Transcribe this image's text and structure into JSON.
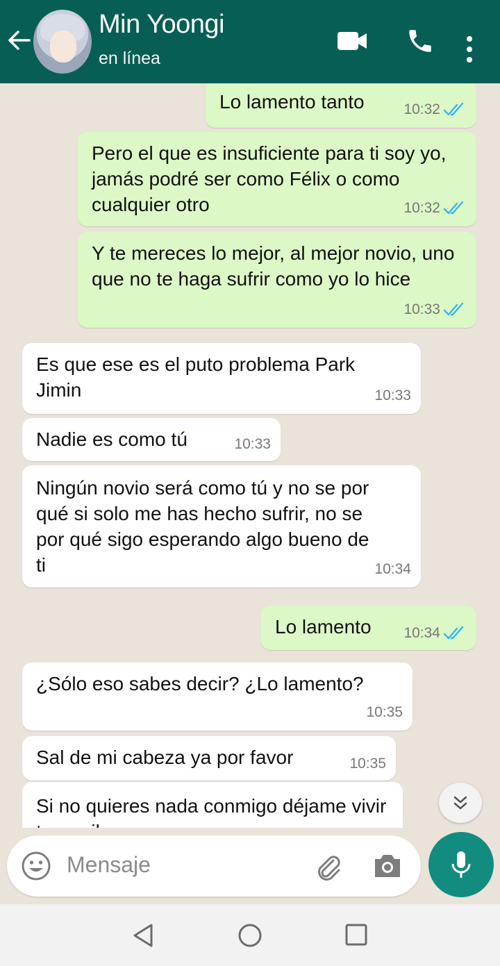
{
  "header": {
    "contact_name": "Min Yoongi",
    "status": "en línea",
    "icons": [
      "back-arrow-icon",
      "video-call-icon",
      "voice-call-icon",
      "more-options-icon"
    ]
  },
  "messages": [
    {
      "direction": "out",
      "text": "Lo lamento tanto",
      "time": "10:32",
      "read": true
    },
    {
      "direction": "out",
      "text": "Pero el que es insuficiente para ti soy yo, jamás podré ser como Félix o como cualquier otro",
      "time": "10:32",
      "read": true
    },
    {
      "direction": "out",
      "text": "Y te mereces lo mejor, al mejor novio, uno que no te haga sufrir como yo lo hice",
      "time": "10:33",
      "read": true
    },
    {
      "direction": "in",
      "text": "Es que ese es el puto problema Park Jimin",
      "time": "10:33"
    },
    {
      "direction": "in",
      "text": "Nadie es como tú",
      "time": "10:33"
    },
    {
      "direction": "in",
      "text": "Ningún novio será como tú y no se por qué si solo me has hecho sufrir, no se por qué sigo esperando algo bueno de ti",
      "time": "10:34"
    },
    {
      "direction": "out",
      "text": "Lo lamento",
      "time": "10:34",
      "read": true
    },
    {
      "direction": "in",
      "text": "¿Sólo eso sabes decir? ¿Lo lamento?",
      "time": "10:35"
    },
    {
      "direction": "in",
      "text": "Sal de mi cabeza ya por favor",
      "time": "10:35"
    },
    {
      "direction": "in",
      "text": "Si no quieres nada conmigo déjame vivir tranquilo",
      "time": ""
    }
  ],
  "composer": {
    "placeholder": "Mensaje",
    "icons": [
      "emoji-icon",
      "attach-icon",
      "camera-icon",
      "mic-icon"
    ]
  },
  "colors": {
    "header": "#075e54",
    "outgoing_bubble": "#dcf8c6",
    "incoming_bubble": "#ffffff",
    "chat_background": "#e9e3da",
    "read_tick": "#34b7f1",
    "mic_button": "#128c7e"
  }
}
